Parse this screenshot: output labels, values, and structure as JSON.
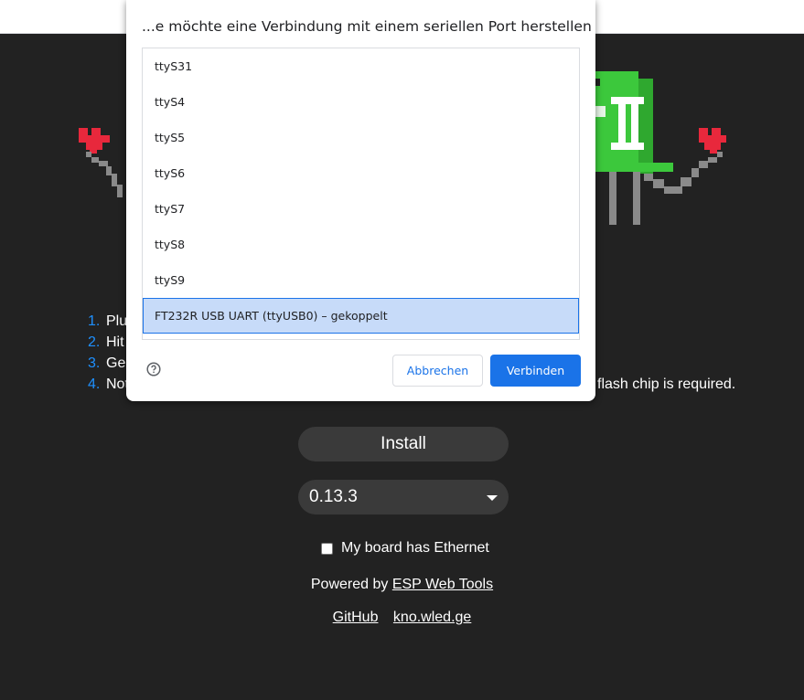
{
  "colors": {
    "page_bg": "#222222",
    "step_number": "#1e90ff",
    "accent": "#1a73e8",
    "selected_row": "#c7dbf9",
    "led_green": "#3cc83c",
    "heart": "#e8283c"
  },
  "steps": [
    {
      "num": "1.",
      "text": "Plu"
    },
    {
      "num": "2.",
      "text": "Hit"
    },
    {
      "num": "3.",
      "text": "Ge"
    },
    {
      "num": "4.",
      "text": "Not",
      "tail": "flash chip is required."
    }
  ],
  "install": {
    "label": "Install"
  },
  "version": {
    "selected": "0.13.3"
  },
  "ethernet": {
    "label": "My board has Ethernet",
    "checked": false
  },
  "powered": {
    "prefix": "Powered by ",
    "link": "ESP Web Tools"
  },
  "footer_links": [
    "GitHub",
    "kno.wled.ge"
  ],
  "dialog": {
    "title": "...e möchte eine Verbindung mit einem seriellen Port herstellen",
    "ports": [
      "ttyS31",
      "ttyS4",
      "ttyS5",
      "ttyS6",
      "ttyS7",
      "ttyS8",
      "ttyS9",
      "FT232R USB UART (ttyUSB0) – gekoppelt"
    ],
    "selected_port": "FT232R USB UART (ttyUSB0) – gekoppelt",
    "help_icon": "help-circle-icon",
    "cancel_label": "Abbrechen",
    "connect_label": "Verbinden"
  }
}
